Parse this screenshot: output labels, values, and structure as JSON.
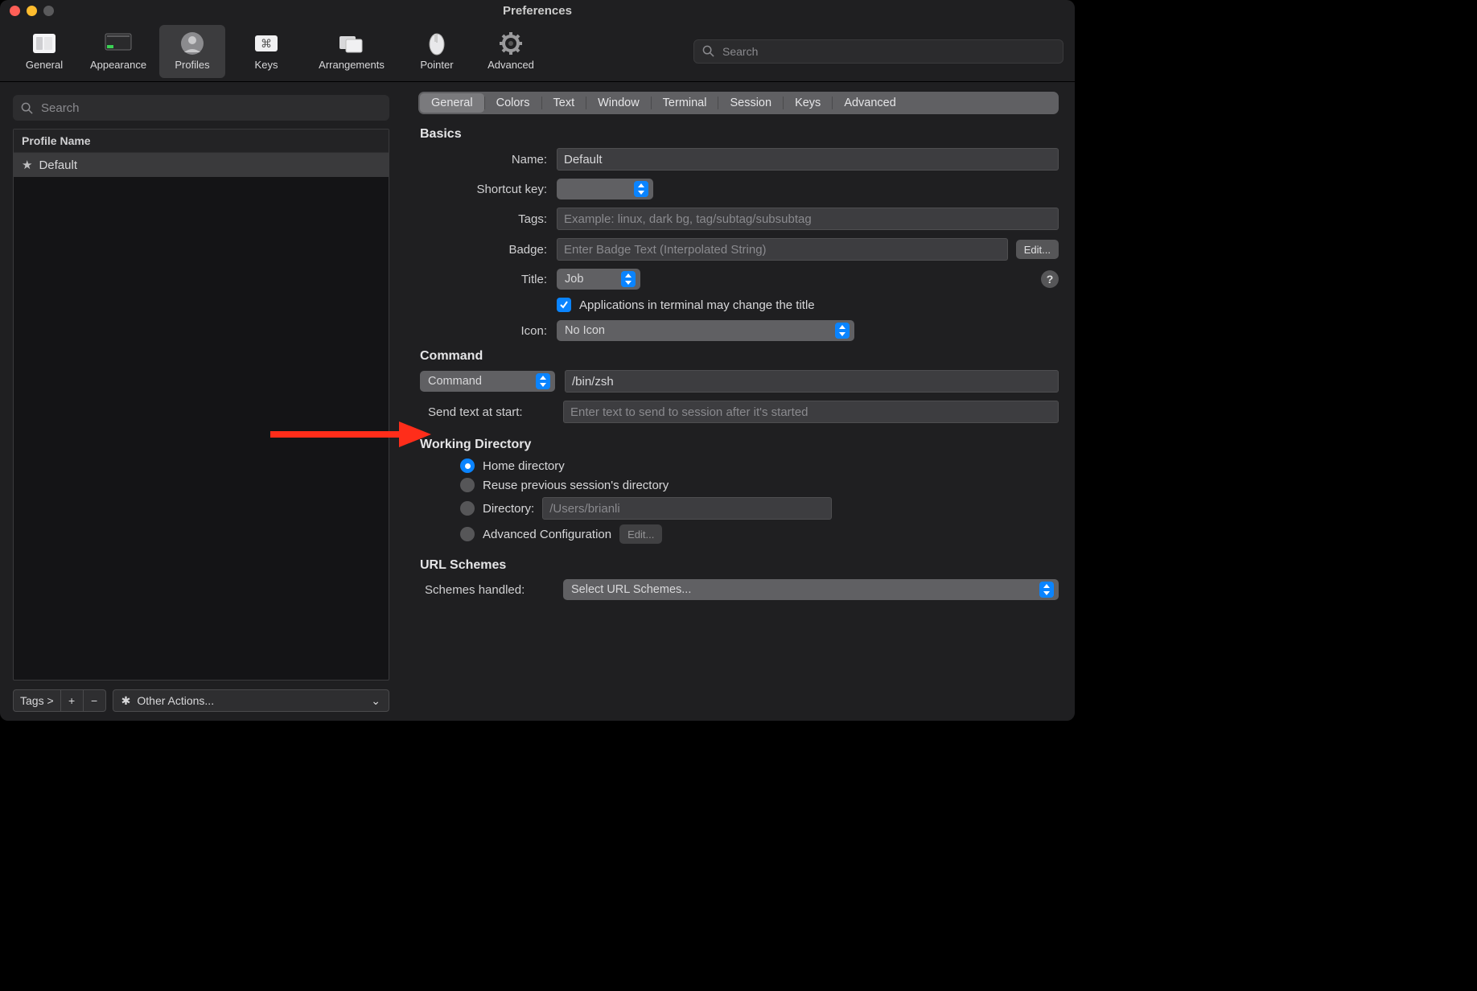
{
  "window": {
    "title": "Preferences"
  },
  "toolbar": {
    "items": [
      {
        "label": "General"
      },
      {
        "label": "Appearance"
      },
      {
        "label": "Profiles"
      },
      {
        "label": "Keys"
      },
      {
        "label": "Arrangements"
      },
      {
        "label": "Pointer"
      },
      {
        "label": "Advanced"
      }
    ],
    "search_placeholder": "Search"
  },
  "sidebar": {
    "search_placeholder": "Search",
    "header": "Profile Name",
    "profiles": [
      {
        "name": "Default",
        "starred": true
      }
    ],
    "footer": {
      "tags_label": "Tags >",
      "other_actions_label": "Other Actions..."
    }
  },
  "tabs": [
    "General",
    "Colors",
    "Text",
    "Window",
    "Terminal",
    "Session",
    "Keys",
    "Advanced"
  ],
  "basics": {
    "heading": "Basics",
    "name_label": "Name:",
    "name_value": "Default",
    "shortcut_label": "Shortcut key:",
    "shortcut_value": "",
    "tags_label": "Tags:",
    "tags_placeholder": "Example: linux, dark bg, tag/subtag/subsubtag",
    "badge_label": "Badge:",
    "badge_placeholder": "Enter Badge Text (Interpolated String)",
    "badge_edit": "Edit...",
    "title_label": "Title:",
    "title_value": "Job",
    "apps_change_title": "Applications in terminal may change the title",
    "icon_label": "Icon:",
    "icon_value": "No Icon"
  },
  "command": {
    "heading": "Command",
    "type_value": "Command",
    "command_value": "/bin/zsh",
    "send_label": "Send text at start:",
    "send_placeholder": "Enter text to send to session after it's started"
  },
  "wd": {
    "heading": "Working Directory",
    "opt_home": "Home directory",
    "opt_reuse": "Reuse previous session's directory",
    "opt_dir": "Directory:",
    "dir_placeholder": "/Users/brianli",
    "opt_adv": "Advanced Configuration",
    "adv_edit": "Edit..."
  },
  "url": {
    "heading": "URL Schemes",
    "label": "Schemes handled:",
    "value": "Select URL Schemes..."
  }
}
